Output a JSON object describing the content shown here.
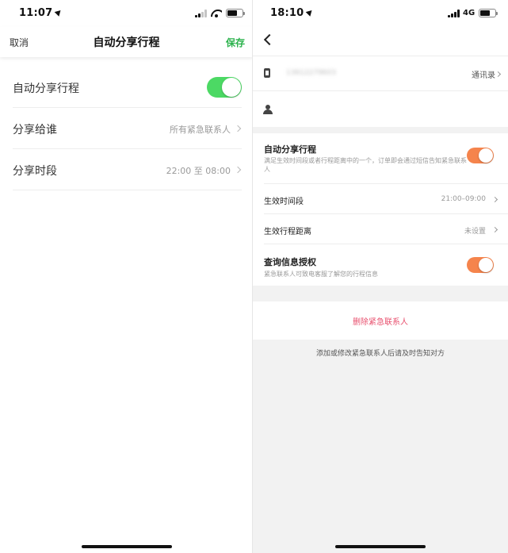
{
  "left_screen": {
    "status": {
      "time": "11:07"
    },
    "nav": {
      "cancel": "取消",
      "title": "自动分享行程",
      "save": "保存"
    },
    "rows": [
      {
        "label": "自动分享行程",
        "toggle_on": true
      },
      {
        "label": "分享给谁",
        "value": "所有紧急联系人"
      },
      {
        "label": "分享时段",
        "value": "22:00 至 08:00"
      }
    ]
  },
  "right_screen": {
    "status": {
      "time": "18:10",
      "network": "4G"
    },
    "contact": {
      "phone_number_masked": "13612279603",
      "contacts_link": "通讯录"
    },
    "auto_share": {
      "title": "自动分享行程",
      "description": "满足生效时间段或者行程距离中的一个，订单即会通过短信告知紧急联系人",
      "toggle_on": true
    },
    "effective_time": {
      "label": "生效时间段",
      "value": "21:00–09:00"
    },
    "effective_distance": {
      "label": "生效行程距离",
      "value": "未设置"
    },
    "query_auth": {
      "title": "查询信息授权",
      "description": "紧急联系人可致电客服了解您的行程信息",
      "toggle_on": true
    },
    "delete_label": "删除紧急联系人",
    "footer_note": "添加或修改紧急联系人后请及时告知对方"
  },
  "colors": {
    "green_toggle": "#4cd964",
    "orange_toggle": "#f5844c",
    "save_green": "#2bb24c",
    "delete_red": "#e8506e"
  },
  "icons": [
    "location-arrow-icon",
    "signal-icon",
    "wifi-icon",
    "battery-icon",
    "back-icon",
    "phone-icon",
    "person-icon",
    "chevron-right-icon"
  ]
}
